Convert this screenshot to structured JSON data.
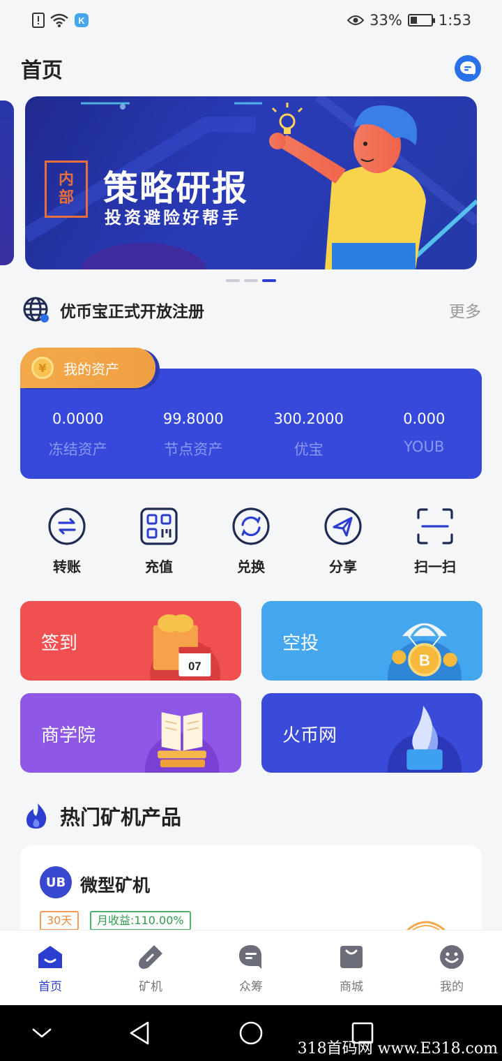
{
  "status_bar": {
    "battery": "33%",
    "battery_level": 0.33,
    "time": "1:53"
  },
  "header": {
    "title": "首页"
  },
  "banner": {
    "badge_top": "内",
    "badge_bottom": "部",
    "title": "策略研报",
    "subtitle": "投资避险好帮手",
    "page_count": 3,
    "active_page": 3
  },
  "notice": {
    "text": "优币宝正式开放注册",
    "more": "更多"
  },
  "assets": {
    "tab_label": "我的资产",
    "items": [
      {
        "value": "0.0000",
        "label": "冻结资产"
      },
      {
        "value": "99.8000",
        "label": "节点资产"
      },
      {
        "value": "300.2000",
        "label": "优宝"
      },
      {
        "value": "0.000",
        "label": "YOUB"
      }
    ]
  },
  "actions": [
    {
      "label": "转账",
      "icon": "transfer-icon"
    },
    {
      "label": "充值",
      "icon": "qrcode-icon"
    },
    {
      "label": "兑换",
      "icon": "exchange-icon"
    },
    {
      "label": "分享",
      "icon": "share-icon"
    },
    {
      "label": "扫一扫",
      "icon": "scan-icon"
    }
  ],
  "features": {
    "signin": {
      "label": "签到",
      "calendar_day": "07"
    },
    "airdrop": {
      "label": "空投"
    },
    "academy": {
      "label": "商学院"
    },
    "huobi": {
      "label": "火币网"
    }
  },
  "hot": {
    "title": "热门矿机产品"
  },
  "product": {
    "logo_text": "UB",
    "name": "微型矿机",
    "days_tag": "30天",
    "yield_tag": "月收益:110.00%"
  },
  "bottom_nav": [
    {
      "label": "首页",
      "icon": "home-icon",
      "active": true
    },
    {
      "label": "矿机",
      "icon": "miner-icon",
      "active": false
    },
    {
      "label": "众筹",
      "icon": "crowdfund-icon",
      "active": false
    },
    {
      "label": "商城",
      "icon": "shop-icon",
      "active": false
    },
    {
      "label": "我的",
      "icon": "profile-icon",
      "active": false
    }
  ],
  "watermark": "318首码网  www.E318.com",
  "colors": {
    "primary": "#3749da",
    "accent_orange": "#f3a94b",
    "signin_red": "#f15050",
    "airdrop_blue": "#44a6ee",
    "academy_purple": "#8f57e6",
    "huobi_indigo": "#3b4bd9"
  }
}
